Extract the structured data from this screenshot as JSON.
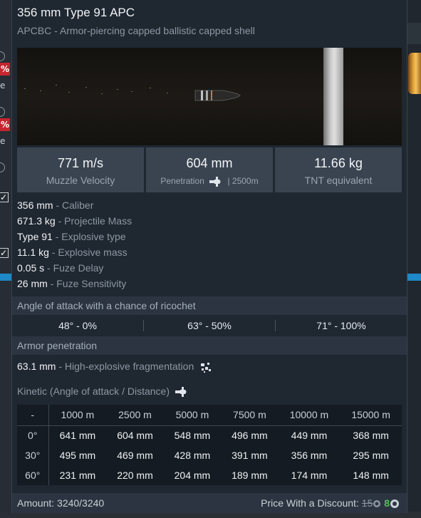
{
  "shell": {
    "name": "356 mm Type 91 APC",
    "description": "APCBC - Armor-piercing capped ballistic capped shell"
  },
  "stats": [
    {
      "value": "771 m/s",
      "label": "Muzzle Velocity"
    },
    {
      "value": "604 mm",
      "label_prefix": "Penetration",
      "label_suffix": "| 2500m"
    },
    {
      "value": "11.66 kg",
      "label": "TNT equivalent"
    }
  ],
  "properties": [
    {
      "value": "356 mm",
      "key": "Caliber"
    },
    {
      "value": "671.3 kg",
      "key": "Projectile Mass"
    },
    {
      "value": "Type 91",
      "key": "Explosive type"
    },
    {
      "value": "11.1 kg",
      "key": "Explosive mass"
    },
    {
      "value": "0.05 s",
      "key": "Fuze Delay"
    },
    {
      "value": "26 mm",
      "key": "Fuze Sensitivity"
    }
  ],
  "ricochet": {
    "title": "Angle of attack with a chance of ricochet",
    "cells": [
      "48° - 0%",
      "63° - 50%",
      "71° - 100%"
    ]
  },
  "armor_penetration": {
    "title": "Armor penetration",
    "he_value": "63.1 mm",
    "he_label": "High-explosive fragmentation",
    "kinetic_title": "Kinetic (Angle of attack / Distance)",
    "corner": "-",
    "distances": [
      "1000 m",
      "2500 m",
      "5000 m",
      "7500 m",
      "10000 m",
      "15000 m"
    ],
    "rows": [
      {
        "angle": "0°",
        "values": [
          "641 mm",
          "604 mm",
          "548 mm",
          "496 mm",
          "449 mm",
          "368 mm"
        ]
      },
      {
        "angle": "30°",
        "values": [
          "495 mm",
          "469 mm",
          "428 mm",
          "391 mm",
          "356 mm",
          "295 mm"
        ]
      },
      {
        "angle": "60°",
        "values": [
          "231 mm",
          "220 mm",
          "204 mm",
          "189 mm",
          "174 mm",
          "148 mm"
        ]
      }
    ]
  },
  "footer": {
    "amount": "Amount: 3240/3240",
    "price_label": "Price With a Discount:",
    "old_price": "15",
    "new_price": "8"
  },
  "background": {
    "percent_badge": "%",
    "letter": "e"
  },
  "colors": {
    "panel_bg": "#1f2731",
    "stat_box": "#3a4451",
    "discount_green": "#53c253",
    "badge_red": "#c6252f",
    "accent_blue": "#1e88c8"
  },
  "icons": {
    "penetration": "shell-penetration-icon",
    "he_frag": "fragmentation-icon",
    "currency": "silver-lions-icon"
  }
}
